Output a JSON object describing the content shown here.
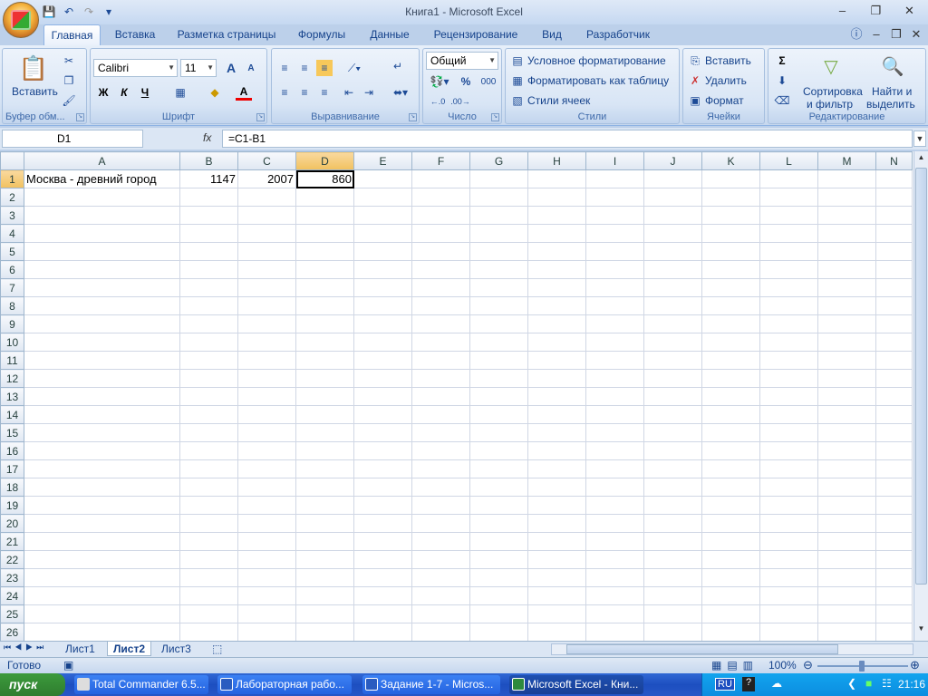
{
  "window": {
    "title": "Книга1 - Microsoft Excel"
  },
  "quick_access": {
    "items": [
      "save-icon",
      "undo-icon",
      "redo-icon",
      "customize-icon"
    ]
  },
  "tabs": [
    "Главная",
    "Вставка",
    "Разметка страницы",
    "Формулы",
    "Данные",
    "Рецензирование",
    "Вид",
    "Разработчик"
  ],
  "ribbon": {
    "clipboard": {
      "label": "Буфер обм...",
      "paste": "Вставить"
    },
    "font": {
      "label": "Шрифт",
      "font_name": "Calibri",
      "font_size": "11",
      "bold": "Ж",
      "italic": "К",
      "underline": "Ч",
      "grow": "A",
      "shrink": "A",
      "font_color": "A"
    },
    "alignment": {
      "label": "Выравнивание"
    },
    "number": {
      "label": "Число",
      "format": "Общий",
      "percent": "%",
      "thousands": "000"
    },
    "styles": {
      "label": "Стили",
      "conditional": "Условное форматирование",
      "as_table": "Форматировать как таблицу",
      "cell_styles": "Стили ячеек"
    },
    "cells": {
      "label": "Ячейки",
      "insert": "Вставить",
      "delete": "Удалить",
      "format": "Формат"
    },
    "editing": {
      "label": "Редактирование",
      "sort_1": "Сортировка",
      "sort_2": "и фильтр",
      "find_1": "Найти и",
      "find_2": "выделить"
    }
  },
  "formula_bar": {
    "name_box": "D1",
    "fx": "fx",
    "formula": "=C1-B1"
  },
  "sheet": {
    "columns": [
      "A",
      "B",
      "C",
      "D",
      "E",
      "F",
      "G",
      "H",
      "I",
      "J",
      "K",
      "L",
      "M",
      "N"
    ],
    "selected_column": "D",
    "rows": [
      "1",
      "2",
      "3",
      "4",
      "5",
      "6",
      "7",
      "8",
      "9",
      "10",
      "11",
      "12",
      "13",
      "14",
      "15",
      "16",
      "17",
      "18",
      "19",
      "20",
      "21",
      "22",
      "23",
      "24",
      "25",
      "26"
    ],
    "cells": {
      "A1": "Москва - древний город",
      "B1": "1147",
      "C1": "2007",
      "D1": "860"
    },
    "active_cell": "D1"
  },
  "sheet_tabs": [
    "Лист1",
    "Лист2",
    "Лист3"
  ],
  "active_sheet": "Лист2",
  "status": {
    "text": "Готово",
    "zoom": "100%"
  },
  "taskbar": {
    "start": "пуск",
    "tasks": [
      "Total Commander 6.5...",
      "Лабораторная рабо...",
      "Задание 1-7 - Micros...",
      "Microsoft Excel - Кни..."
    ],
    "lang": "RU",
    "clock": "21:16"
  },
  "colors": {
    "ribbon": "#dbe6f4",
    "selected_header": "#f9d99f",
    "taskbar": "#245edb"
  }
}
